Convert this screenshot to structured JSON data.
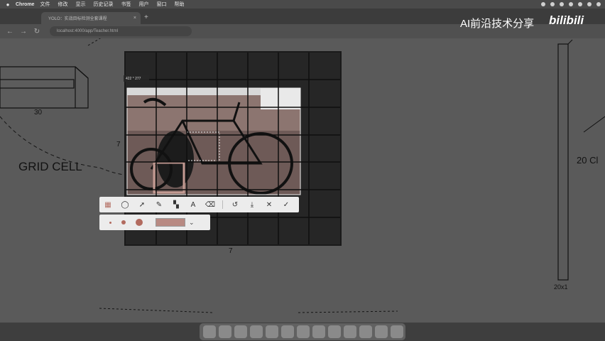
{
  "menubar": {
    "app_name": "Chrome",
    "items": [
      "文件",
      "修改",
      "显示",
      "历史记录",
      "书签",
      "用户",
      "窗口",
      "帮助"
    ]
  },
  "browser": {
    "tab_title": "YOLO：实战目标检测全套课程",
    "url": "localhost:4000/app/Teacher.html"
  },
  "slide": {
    "grid_cell_label": "GRID CELL",
    "label_30": "30",
    "label_7_left": "7",
    "label_7_bottom": "7",
    "label_20_cl": "20  Cl",
    "label_20x1": "20x1"
  },
  "screenshot_tool": {
    "size_readout": "422 * 277",
    "tools": [
      {
        "name": "mosaic-tool",
        "glyph": "▦",
        "active": true
      },
      {
        "name": "ellipse-tool",
        "glyph": "◯"
      },
      {
        "name": "arrow-tool",
        "glyph": "➚"
      },
      {
        "name": "pen-tool",
        "glyph": "✎"
      },
      {
        "name": "blur-tool",
        "glyph": "▚"
      },
      {
        "name": "text-tool",
        "glyph": "A"
      },
      {
        "name": "eraser-tool",
        "glyph": "⌫"
      },
      {
        "name": "undo-button",
        "glyph": "↺"
      },
      {
        "name": "download-button",
        "glyph": "⤓"
      },
      {
        "name": "cancel-button",
        "glyph": "✕"
      },
      {
        "name": "confirm-button",
        "glyph": "✓"
      }
    ],
    "active_color": "#b26b5f",
    "swatch_color": "#b88a83"
  },
  "watermark": {
    "text": "AI前沿技术分享",
    "logo": "bilibili"
  }
}
